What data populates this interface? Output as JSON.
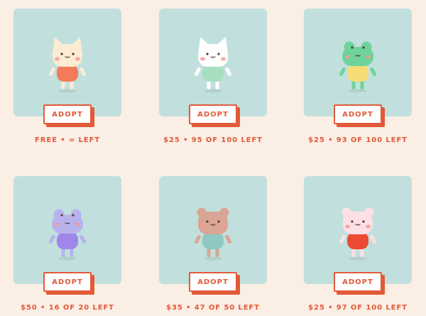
{
  "colors": {
    "background": "#faeee5",
    "card_panel": "#c1e0dd",
    "accent": "#e25a39",
    "button_fill": "#ffffff"
  },
  "pets": [
    {
      "name": "cream-cat",
      "icon": "cat-icon",
      "button_label": "ADOPT",
      "caption": "FREE • ∞ LEFT",
      "colors": {
        "head": "#fbecd3",
        "body": "#f47a5a",
        "limbs": "#fbecd3"
      }
    },
    {
      "name": "white-cat",
      "icon": "cat-icon",
      "button_label": "ADOPT",
      "caption": "$25 • 95 OF 100 LEFT",
      "colors": {
        "head": "#ffffff",
        "body": "#a6dec0",
        "limbs": "#ffffff"
      }
    },
    {
      "name": "green-frog",
      "icon": "frog-icon",
      "button_label": "ADOPT",
      "caption": "$25 • 93 OF 100 LEFT",
      "colors": {
        "head": "#6ed39a",
        "body": "#f7dc76",
        "limbs": "#6ed39a"
      }
    },
    {
      "name": "lavender-frog",
      "icon": "frog-icon",
      "button_label": "ADOPT",
      "caption": "$50 • 16 OF 20 LEFT",
      "colors": {
        "head": "#b7b2ee",
        "body": "#9e86eb",
        "limbs": "#b7b2ee"
      }
    },
    {
      "name": "brown-bear",
      "icon": "bear-icon",
      "button_label": "ADOPT",
      "caption": "$35 • 47 OF 50 LEFT",
      "colors": {
        "head": "#d9a594",
        "body": "#8fc8c0",
        "limbs": "#d9a594"
      }
    },
    {
      "name": "pink-bear",
      "icon": "bear-icon",
      "button_label": "ADOPT",
      "caption": "$25 • 97 OF 100 LEFT",
      "colors": {
        "head": "#fde0e6",
        "body": "#ec4a32",
        "limbs": "#fde0e6"
      }
    }
  ]
}
